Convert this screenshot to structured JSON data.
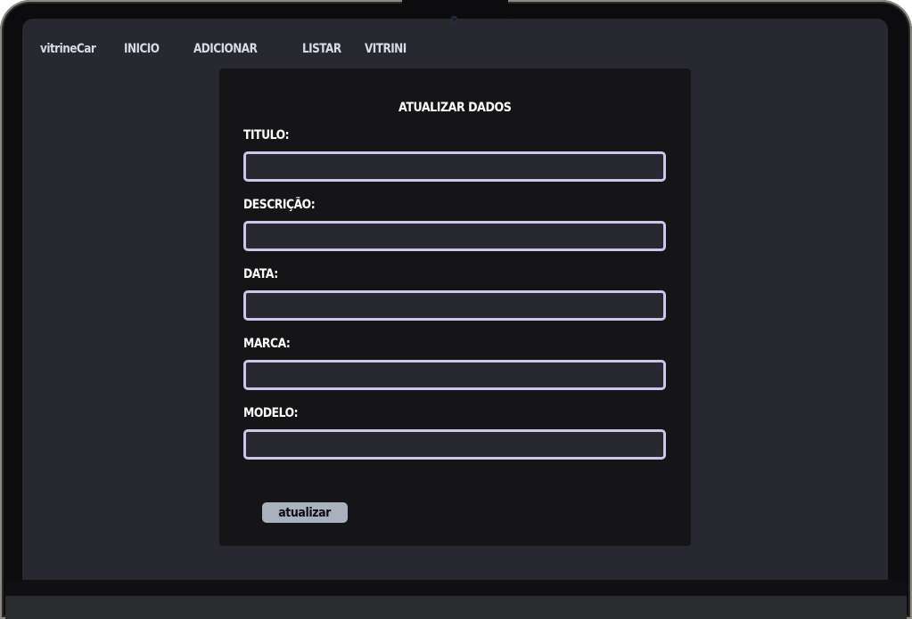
{
  "nav": {
    "brand": "vitrineCar",
    "items": [
      {
        "label": "INICIO"
      },
      {
        "label": "ADICIONAR"
      },
      {
        "label": "LISTAR"
      },
      {
        "label": "VITRINI"
      }
    ]
  },
  "form": {
    "title": "ATUALIZAR DADOS",
    "fields": [
      {
        "label": "TITULO:",
        "value": ""
      },
      {
        "label": "DESCRIÇÃO:",
        "value": ""
      },
      {
        "label": "DATA:",
        "value": ""
      },
      {
        "label": "MARCA:",
        "value": ""
      },
      {
        "label": "MODELO:",
        "value": ""
      }
    ],
    "submit_label": "atualizar"
  },
  "colors": {
    "screen_background": "#272830",
    "card_background": "#151517",
    "input_border": "#cbc6ea",
    "button_background": "#a9b1bf"
  }
}
